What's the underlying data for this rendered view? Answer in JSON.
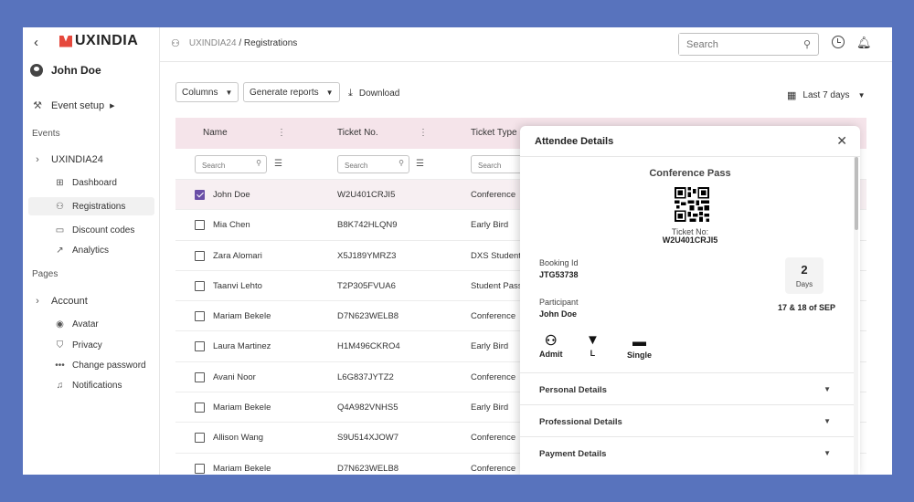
{
  "sidebar": {
    "back_icon": "chevron-left-icon",
    "logo": "UXINDIA",
    "user_name": "John Doe",
    "event_setup": "Event setup",
    "events_heading": "Events",
    "event_name": "UXINDIA24",
    "event_items": [
      {
        "label": "Dashboard",
        "icon": "dashboard-icon"
      },
      {
        "label": "Registrations",
        "icon": "users-icon"
      },
      {
        "label": "Discount codes",
        "icon": "ticket-icon"
      },
      {
        "label": "Analytics",
        "icon": "trend-icon"
      }
    ],
    "pages_heading": "Pages",
    "account": "Account",
    "account_items": [
      {
        "label": "Avatar",
        "icon": "user-circle-icon"
      },
      {
        "label": "Privacy",
        "icon": "shield-icon"
      },
      {
        "label": "Change password",
        "icon": "password-dots-icon"
      },
      {
        "label": "Notifications",
        "icon": "bell-icon"
      }
    ]
  },
  "topbar": {
    "breadcrumb_root": "UXINDIA24",
    "breadcrumb_sep": " / ",
    "breadcrumb_current": "Registrations",
    "search_placeholder": "Search"
  },
  "toolbar": {
    "columns": "Columns",
    "generate_reports": "Generate reports",
    "download": "Download",
    "date_range": "Last 7 days"
  },
  "table": {
    "columns": [
      "Name",
      "Ticket No.",
      "Ticket Type"
    ],
    "filter_placeholder": "Search",
    "rows": [
      {
        "name": "John Doe",
        "ticket": "W2U401CRJI5",
        "type": "Conference",
        "selected": true
      },
      {
        "name": "Mia Chen",
        "ticket": "B8K742HLQN9",
        "type": "Early Bird",
        "selected": false
      },
      {
        "name": "Zara Alomari",
        "ticket": "X5J189YMRZ3",
        "type": "DXS Student",
        "selected": false
      },
      {
        "name": "Taanvi Lehto",
        "ticket": "T2P305FVUA6",
        "type": "Student Pass",
        "selected": false
      },
      {
        "name": "Mariam Bekele",
        "ticket": "D7N623WELB8",
        "type": "Conference",
        "selected": false
      },
      {
        "name": "Laura Martinez",
        "ticket": "H1M496CKRO4",
        "type": "Early Bird",
        "selected": false
      },
      {
        "name": "Avani Noor",
        "ticket": "L6G837JYTZ2",
        "type": "Conference",
        "selected": false
      },
      {
        "name": "Mariam Bekele",
        "ticket": "Q4A982VNHS5",
        "type": "Early Bird",
        "selected": false
      },
      {
        "name": "Allison Wang",
        "ticket": "S9U514XJOW7",
        "type": "Conference",
        "selected": false
      },
      {
        "name": "Mariam Bekele",
        "ticket": "D7N623WELB8",
        "type": "Conference",
        "selected": false
      }
    ]
  },
  "modal": {
    "title": "Attendee Details",
    "pass_title": "Conference Pass",
    "ticket_label": "Ticket No:",
    "ticket_no": "W2U401CRJI5",
    "booking_label": "Booking Id",
    "booking_id": "JTG53738",
    "participant_label": "Participant",
    "participant": "John Doe",
    "days_count": "2",
    "days_label": "Days",
    "dates": "17 & 18 of SEP",
    "amenities": [
      {
        "label": "Admit",
        "icon": "group-icon"
      },
      {
        "label": "L",
        "icon": "tshirt-icon"
      },
      {
        "label": "Single",
        "icon": "bed-icon"
      }
    ],
    "sections": [
      "Personal Details",
      "Professional Details",
      "Payment Details"
    ]
  },
  "colors": {
    "background": "#5873bd",
    "table_header": "#f5e4ea",
    "checkbox_accent": "#6a4ea6",
    "logo_red": "#e5483c"
  }
}
